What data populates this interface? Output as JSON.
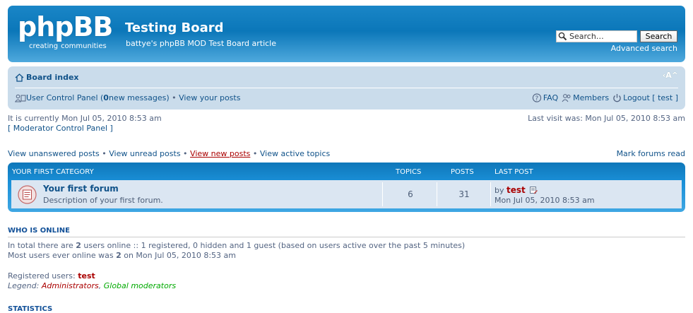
{
  "header": {
    "logo_text": "phpBB",
    "logo_sub_1": "creating",
    "logo_sub_2": "communities",
    "site_title": "Testing Board",
    "site_description": "battye's phpBB MOD Test Board article",
    "search_value": "Search…",
    "search_button": "Search",
    "advanced_search": "Advanced search"
  },
  "navbar": {
    "board_index": "Board index",
    "font_controls": "‹A^",
    "ucp_label": "User Control Panel (",
    "new_messages_count": "0",
    "new_messages_suffix": " new messages)",
    "bullet": " • ",
    "view_posts": "View your posts",
    "faq": "FAQ",
    "members": "Members",
    "logout": "Logout [ test ]"
  },
  "time": {
    "current": "It is currently Mon Jul 05, 2010 8:53 am",
    "mcp": "[ Moderator Control Panel ]",
    "last_visit": "Last visit was: Mon Jul 05, 2010 8:53 am"
  },
  "search_links": {
    "unanswered": "View unanswered posts",
    "unread": "View unread posts",
    "new_posts": "View new posts",
    "active": "View active topics",
    "mark_read": "Mark forums read",
    "sep": " • "
  },
  "category": {
    "name": "YOUR FIRST CATEGORY",
    "col_topics": "TOPICS",
    "col_posts": "POSTS",
    "col_last_post": "LAST POST",
    "forum": {
      "title": "Your first forum",
      "description": "Description of your first forum.",
      "topics": "6",
      "posts": "31",
      "last_by": "by ",
      "last_user": "test",
      "last_time": "Mon Jul 05, 2010 8:53 am"
    }
  },
  "online": {
    "heading": "WHO IS ONLINE",
    "line1_a": "In total there are ",
    "line1_count": "2",
    "line1_b": " users online :: 1 registered, 0 hidden and 1 guest (based on users active over the past 5 minutes)",
    "line2_a": "Most users ever online was ",
    "line2_count": "2",
    "line2_b": " on Mon Jul 05, 2010 8:53 am",
    "registered_label": "Registered users: ",
    "registered_user": "test",
    "legend_label": "Legend: ",
    "legend_admin": "Administrators",
    "legend_sep": ", ",
    "legend_gmod": "Global moderators"
  },
  "statistics": {
    "heading": "STATISTICS"
  },
  "colors": {
    "header_blue": "#0b77b9",
    "navbar_bg": "#cadceb",
    "link": "#105289",
    "admin_red": "#aa0000",
    "gmod_green": "#00aa00"
  }
}
